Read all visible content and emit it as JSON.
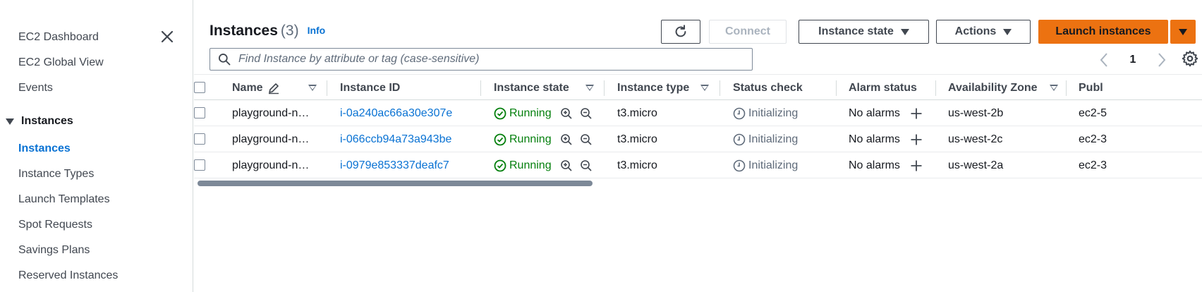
{
  "sidebar": {
    "items_top": [
      {
        "label": "EC2 Dashboard"
      },
      {
        "label": "EC2 Global View"
      },
      {
        "label": "Events"
      }
    ],
    "group": {
      "label": "Instances",
      "expanded": true
    },
    "group_items": [
      {
        "label": "Instances",
        "active": true
      },
      {
        "label": "Instance Types"
      },
      {
        "label": "Launch Templates"
      },
      {
        "label": "Spot Requests"
      },
      {
        "label": "Savings Plans"
      },
      {
        "label": "Reserved Instances"
      }
    ]
  },
  "header": {
    "title": "Instances",
    "count": "(3)",
    "info": "Info"
  },
  "toolbar": {
    "refresh_icon": "refresh-icon",
    "connect": "Connect",
    "instance_state": "Instance state",
    "actions": "Actions",
    "launch": "Launch instances"
  },
  "search": {
    "placeholder": "Find Instance by attribute or tag (case-sensitive)",
    "value": ""
  },
  "pagination": {
    "page": "1"
  },
  "table": {
    "columns": [
      "Name",
      "Instance ID",
      "Instance state",
      "Instance type",
      "Status check",
      "Alarm status",
      "Availability Zone",
      "Publ"
    ],
    "rows": [
      {
        "name": "playground-n…",
        "id": "i-0a240ac66a30e307e",
        "state": "Running",
        "type": "t3.micro",
        "status": "Initializing",
        "alarm": "No alarms",
        "az": "us-west-2b",
        "public": "ec2-5"
      },
      {
        "name": "playground-n…",
        "id": "i-066ccb94a73a943be",
        "state": "Running",
        "type": "t3.micro",
        "status": "Initializing",
        "alarm": "No alarms",
        "az": "us-west-2c",
        "public": "ec2-3"
      },
      {
        "name": "playground-n…",
        "id": "i-0979e853337deafc7",
        "state": "Running",
        "type": "t3.micro",
        "status": "Initializing",
        "alarm": "No alarms",
        "az": "us-west-2a",
        "public": "ec2-3"
      }
    ]
  },
  "colors": {
    "accent": "#0972d3",
    "primary_button": "#ec7211",
    "running": "#037f0c"
  }
}
